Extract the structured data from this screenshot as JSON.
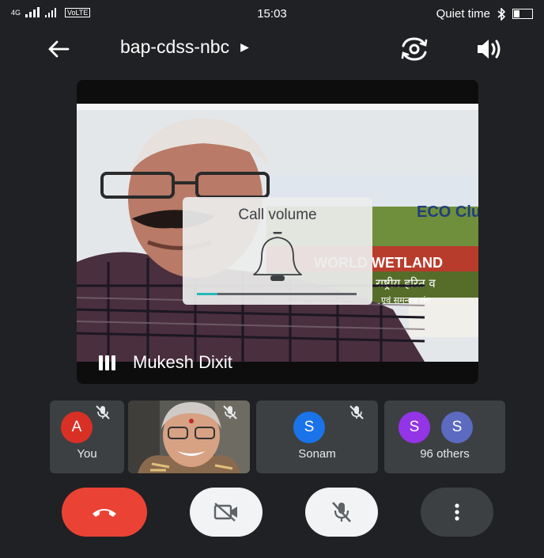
{
  "status_bar": {
    "signal_text": "4G",
    "volte_label": "VoLTE",
    "time": "15:03",
    "mode_text": "Quiet time"
  },
  "header": {
    "meeting_code": "bap-cdss-nbc"
  },
  "main_video": {
    "speaker_name": "Mukesh Dixit",
    "banner_lines": [
      "ECO Club",
      "WORLD WETLAND",
      "राष्ट्रीय हरित व",
      "एवं समन्वय संग"
    ]
  },
  "volume_popup": {
    "title": "Call volume",
    "level_fraction": 0.13
  },
  "participants": [
    {
      "name": "You",
      "initial": "A",
      "color": "#d93025",
      "muted": true
    },
    {
      "name": "",
      "initial": "",
      "color": "",
      "muted": true
    },
    {
      "name": "Sonam",
      "initial": "S",
      "color": "#1a73e8",
      "muted": true
    },
    {
      "name": "96 others",
      "initials": [
        "S",
        "S"
      ],
      "colors": [
        "#9334e6",
        "#5c6bc0"
      ],
      "muted": false
    }
  ],
  "controls": {
    "end_call_color": "#ea4335",
    "icons": [
      "end-call-icon",
      "camera-off-icon",
      "mic-off-icon",
      "more-vert-icon"
    ]
  }
}
